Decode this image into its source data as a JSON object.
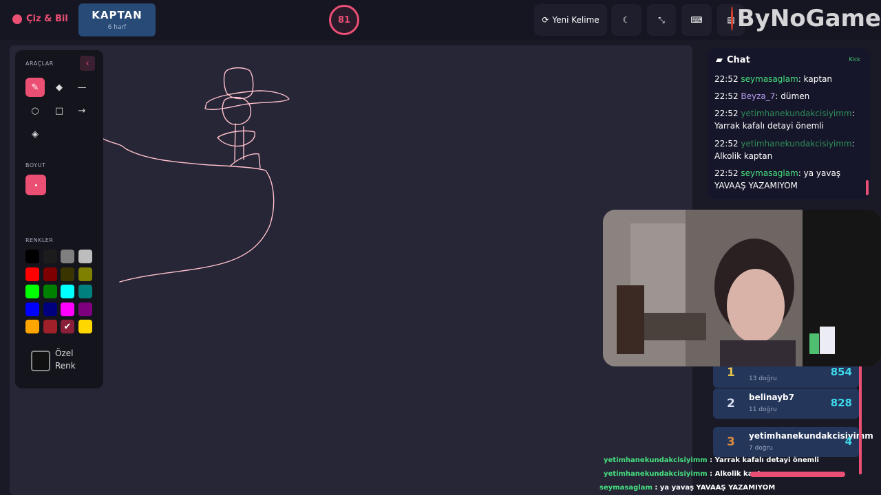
{
  "header": {
    "brand": "Çiz & Bil",
    "word": "KAPTAN",
    "word_hint": "6 harf",
    "timer": "81",
    "new_word_label": "Yeni Kelime",
    "watermark": "ByNoGame"
  },
  "tools_panel": {
    "tools_heading": "ARAÇLAR",
    "size_heading": "BOYUT",
    "colors_heading": "RENKLER",
    "custom_color_label": "Özel Renk",
    "tools": [
      "brush-icon",
      "eraser-icon",
      "line-icon",
      "circle-icon",
      "rectangle-icon",
      "arrow-icon",
      "fill-bucket-icon"
    ],
    "colors": [
      "#000000",
      "#1c1c1c",
      "#7f7f7f",
      "#bdbdbd",
      "#ff0000",
      "#7f0000",
      "#3a3400",
      "#7f7f00",
      "#00ff00",
      "#008000",
      "#00ffff",
      "#007f7f",
      "#0000ff",
      "#00007f",
      "#ff00ff",
      "#7f007f",
      "#ffa500",
      "#a0202a",
      "#ffc0cb",
      "#ffd700"
    ],
    "selected_color": "#ffc0cb"
  },
  "chat": {
    "title": "Chat",
    "source": "Kick",
    "messages": [
      {
        "time": "22:52",
        "user": "seymasaglam",
        "text": ": kaptan",
        "color": "#45e07e"
      },
      {
        "time": "22:52",
        "user": "Beyza_7",
        "text": ": dümen",
        "color": "#b79cf0"
      },
      {
        "time": "22:52",
        "user": "yetimhanekundakcisiyimm",
        "text": ": Yarrak kafalı detayi önemli",
        "color": "#2e8f57"
      },
      {
        "time": "22:52",
        "user": "yetimhanekundakcisiyimm",
        "text": ": Alkolik kaptan",
        "color": "#2e8f57"
      },
      {
        "time": "22:52",
        "user": "seymasaglam",
        "text": ": ya yavaş YAVAAŞ YAZAMIYOM",
        "color": "#45e07e"
      }
    ]
  },
  "leaderboard": [
    {
      "rank": "1",
      "name": "",
      "correct": "13 doğru",
      "score": "854"
    },
    {
      "rank": "2",
      "name": "belinayb7",
      "correct": "11 doğru",
      "score": "828"
    },
    {
      "rank": "3",
      "name": "yetimhanekundakcisiyimm",
      "correct": "7 doğru",
      "score": "4"
    }
  ],
  "overlay_chat": [
    {
      "user": "yetimhanekundakcisiyimm",
      "text": " : Yarrak kafalı detayi önemli"
    },
    {
      "user": "yetimhanekundakcisiyimm",
      "text": " : Alkolik kaptan"
    },
    {
      "user": "seymasaglam",
      "text": " : ya yavaş YAVAAŞ YAZAMIYOM"
    }
  ],
  "colors": {
    "accent": "#ec4f74",
    "stroke": "#ffc0cb"
  }
}
